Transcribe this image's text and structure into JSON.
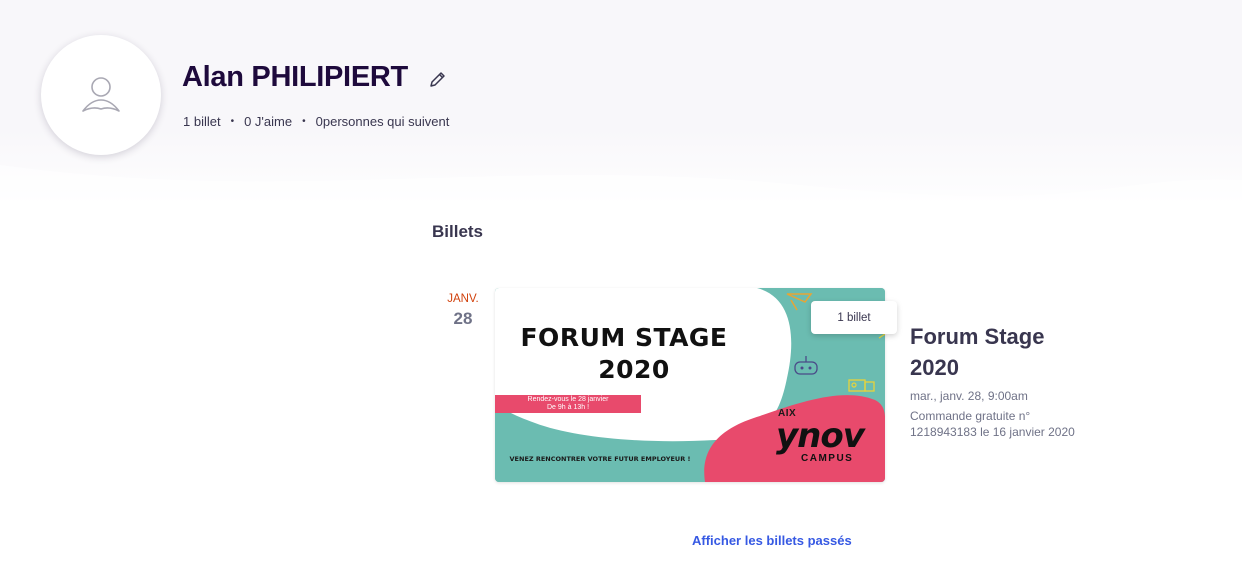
{
  "profile": {
    "name": "Alan PHILIPIERT",
    "stats": {
      "tickets": "1 billet",
      "likes": "0 J'aime",
      "followers": "0personnes qui suivent"
    }
  },
  "tickets_section": {
    "title": "Billets",
    "items": [
      {
        "month": "JANV.",
        "day": "28",
        "ticket_count": "1 billet",
        "title": "Forum Stage 2020",
        "datetime": "mar., janv. 28, 9:00am",
        "order": "Commande gratuite n° 1218943183 le 16 janvier 2020",
        "poster": {
          "title_line1": "FORUM STAGE",
          "title_line2": "2020",
          "rdv_line1": "Rendez-vous le 28 janvier",
          "rdv_line2": "De 9h à 13h !",
          "cta": "VENEZ RENCONTRER VOTRE FUTUR EMPLOYEUR !",
          "brand_prefix": "AIX",
          "brand": "ynov",
          "brand_suffix": "CAMPUS"
        }
      }
    ]
  },
  "past_tickets_link": "Afficher les billets passés",
  "colors": {
    "heading": "#1e0a3c",
    "month": "#d1410c",
    "link": "#3659e3",
    "poster_teal": "#6bbcb1",
    "poster_pink": "#e84a6c"
  },
  "icons": {
    "avatar": "user-placeholder-icon",
    "edit": "pencil-icon"
  }
}
